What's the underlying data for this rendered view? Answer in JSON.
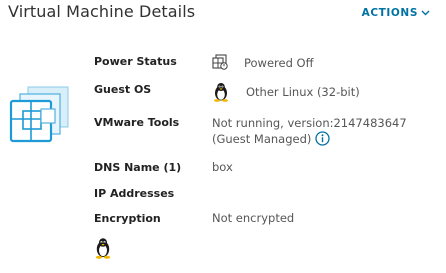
{
  "header": {
    "title": "Virtual Machine Details",
    "actions_label": "ACTIONS"
  },
  "details": {
    "power_status": {
      "label": "Power Status",
      "value": "Powered Off",
      "icon": "power-off-vm-icon"
    },
    "guest_os": {
      "label": "Guest OS",
      "value": "Other Linux (32-bit)",
      "icon": "linux-tux-icon"
    },
    "vmware_tools": {
      "label": "VMware Tools",
      "value": "Not running, version:2147483647 (Guest Managed)",
      "icon": "info-icon"
    },
    "dns_name": {
      "label": "DNS Name (1)",
      "value": "box"
    },
    "ip_addresses": {
      "label": "IP Addresses",
      "value": ""
    },
    "encryption": {
      "label": "Encryption",
      "value": "Not encrypted"
    }
  },
  "colors": {
    "accent": "#0072a3",
    "vm_icon_blue": "#1e9ad6",
    "vm_icon_light": "#d8eef9"
  }
}
